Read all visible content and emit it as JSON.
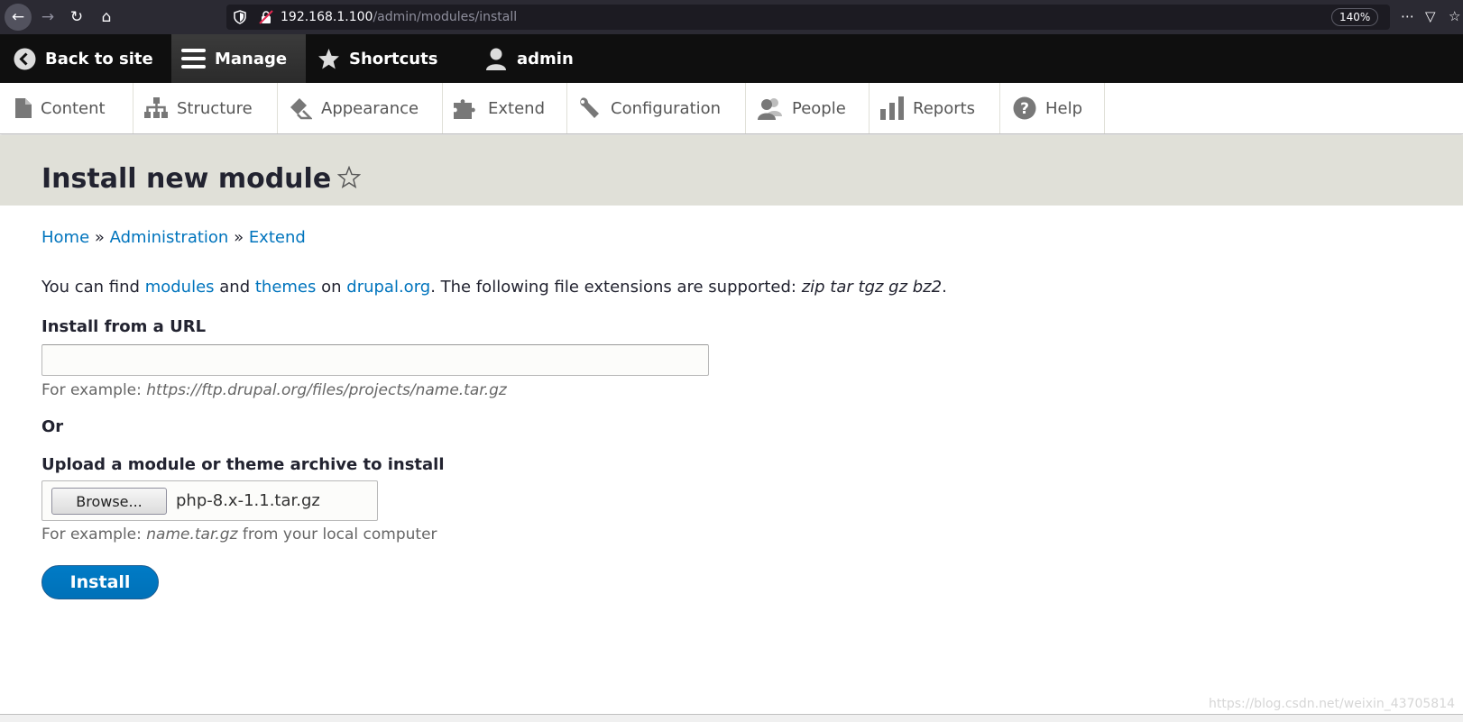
{
  "browser": {
    "url_host": "192.168.1.100",
    "url_path": "/admin/modules/install",
    "zoom": "140%"
  },
  "toolbar": {
    "back_to_site": "Back to site",
    "manage": "Manage",
    "shortcuts": "Shortcuts",
    "user": "admin"
  },
  "tray": {
    "items": [
      {
        "label": "Content",
        "icon": "file-icon"
      },
      {
        "label": "Structure",
        "icon": "sitemap-icon"
      },
      {
        "label": "Appearance",
        "icon": "paintbrush-icon"
      },
      {
        "label": "Extend",
        "icon": "puzzle-icon"
      },
      {
        "label": "Configuration",
        "icon": "wrench-icon"
      },
      {
        "label": "People",
        "icon": "people-icon"
      },
      {
        "label": "Reports",
        "icon": "bar-chart-icon"
      },
      {
        "label": "Help",
        "icon": "question-icon"
      }
    ]
  },
  "page": {
    "title": "Install new module",
    "breadcrumb": [
      "Home",
      "Administration",
      "Extend"
    ],
    "breadcrumb_sep": "»",
    "help": {
      "part1": "You can find ",
      "link_modules": "modules",
      "part2": " and ",
      "link_themes": "themes",
      "part3": " on ",
      "link_drupal": "drupal.org",
      "part4": ". The following file extensions are supported: ",
      "extensions": "zip tar tgz gz bz2",
      "part5": "."
    },
    "url_label": "Install from a URL",
    "url_value": "",
    "url_desc_prefix": "For example: ",
    "url_desc_example": "https://ftp.drupal.org/files/projects/name.tar.gz",
    "or_label": "Or",
    "upload_label": "Upload a module or theme archive to install",
    "browse_label": "Browse...",
    "file_name": "php-8.x-1.1.tar.gz",
    "upload_desc_prefix": "For example: ",
    "upload_desc_example": "name.tar.gz",
    "upload_desc_suffix": " from your local computer",
    "install_label": "Install"
  },
  "watermark": "https://blog.csdn.net/weixin_43705814"
}
